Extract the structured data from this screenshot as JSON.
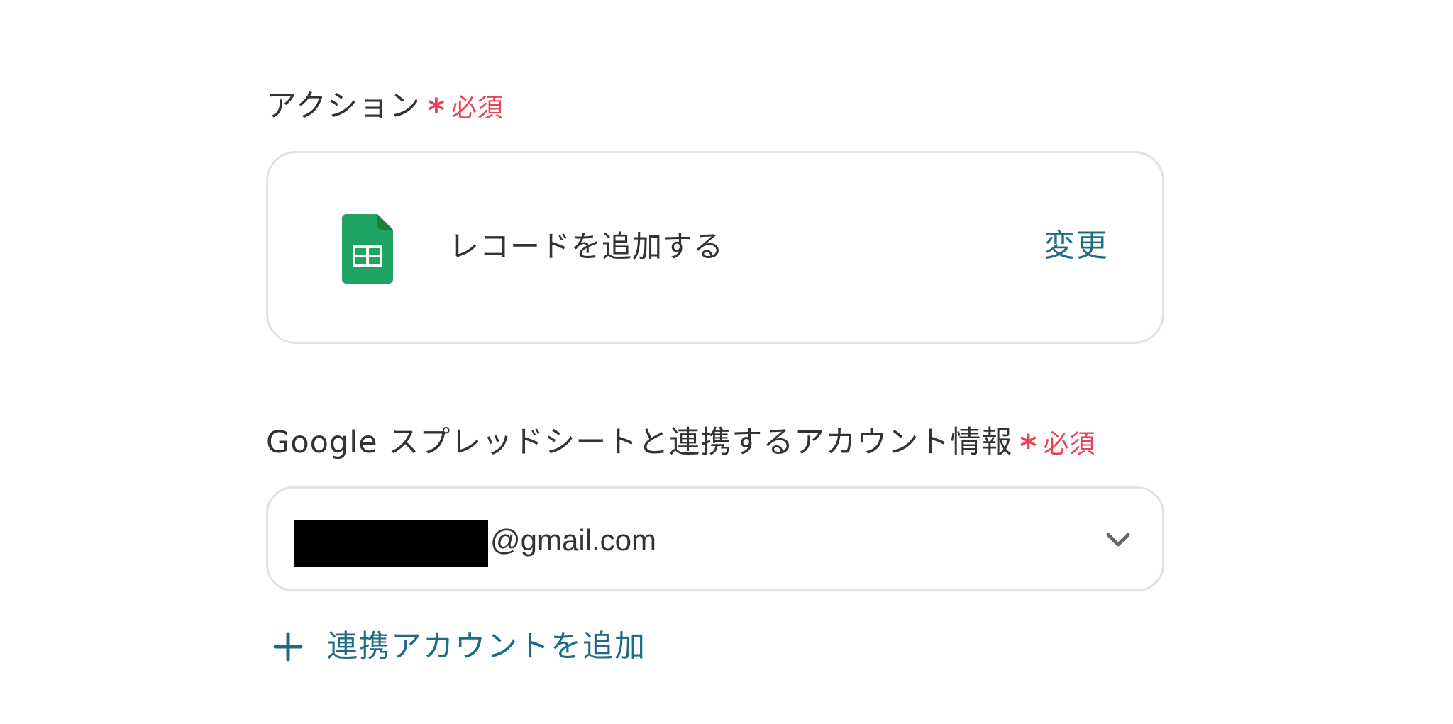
{
  "action_field": {
    "label": "アクション",
    "required_star": "*",
    "required_text": "必須",
    "action_name": "レコードを追加する",
    "change_label": "変更",
    "app_icon": "google-sheets-icon"
  },
  "account_field": {
    "label": "Google スプレッドシートと連携するアカウント情報",
    "required_star": "*",
    "required_text": "必須",
    "account_domain": "@gmail.com",
    "add_account_label": "連携アカウントを追加"
  },
  "colors": {
    "required": "#e8435a",
    "link": "#1e6b86",
    "border": "#e2e2e2",
    "text": "#333333",
    "sheets_green": "#1fa463"
  }
}
